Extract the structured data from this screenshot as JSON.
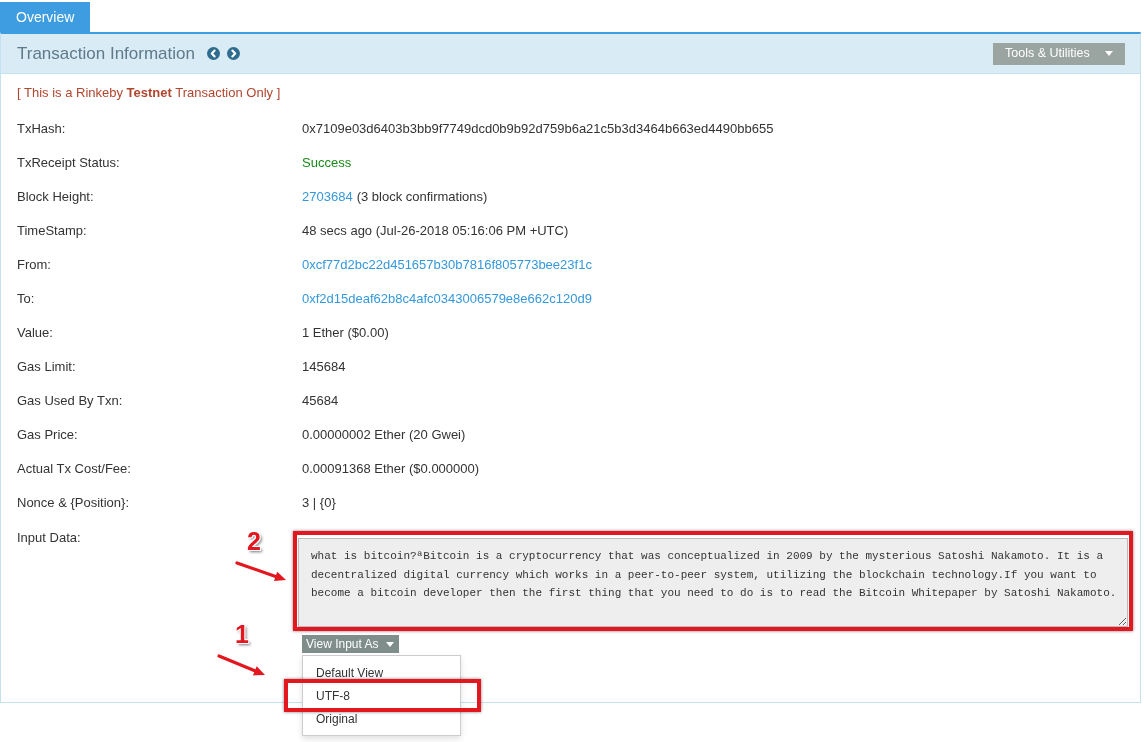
{
  "tabs": [
    {
      "label": "Overview",
      "selected": true
    }
  ],
  "panel": {
    "title": "Transaction Information",
    "tools_button": "Tools & Utilities"
  },
  "notice": "[ This is a Rinkeby **Testnet** Transaction Only ]",
  "fields": [
    {
      "label": "TxHash:",
      "kind": "text",
      "value": "0x7109e03d6403b3bb9f7749dcd0b9b92d759b6a21c5b3d3464b663ed4490bb655"
    },
    {
      "label": "TxReceipt Status:",
      "kind": "status",
      "value": "Success"
    },
    {
      "label": "Block Height:",
      "kind": "link",
      "value": "2703684",
      "note": "(3 block confirmations)"
    },
    {
      "label": "TimeStamp:",
      "kind": "text",
      "value": "48 secs ago (Jul-26-2018 05:16:06 PM +UTC)"
    },
    {
      "label": "From:",
      "kind": "link",
      "value": "0xcf77d2bc22d451657b30b7816f805773bee23f1c"
    },
    {
      "label": "To:",
      "kind": "link",
      "value": "0xf2d15deaf62b8c4afc0343006579e8e662c120d9"
    },
    {
      "label": "Value:",
      "kind": "text",
      "value": "1 Ether ($0.00)"
    },
    {
      "label": "Gas Limit:",
      "kind": "text",
      "value": "145684"
    },
    {
      "label": "Gas Used By Txn:",
      "kind": "text",
      "value": "45684"
    },
    {
      "label": "Gas Price:",
      "kind": "text",
      "value": "0.00000002 Ether (20 Gwei)"
    },
    {
      "label": "Actual Tx Cost/Fee:",
      "kind": "text",
      "value": "0.00091368 Ether ($0.000000)"
    },
    {
      "label": "Nonce & {Position}:",
      "kind": "text",
      "value": "3 | {0}"
    }
  ],
  "input_data": {
    "label": "Input Data:",
    "value": "what is bitcoin?ªBitcoin is a cryptocurrency that was conceptualized in 2009 by the mysterious Satoshi Nakamoto. It is a decentralized digital currency which works in a peer-to-peer system, utilizing the blockchain technology.If you want to become a bitcoin developer then the first thing that you need to do is to read the Bitcoin Whitepaper by Satoshi Nakamoto.",
    "annotation": "2",
    "view_button": "View Input As",
    "menu": [
      {
        "label": "Default View",
        "selected": false
      },
      {
        "label": "UTF-8",
        "selected": false,
        "annotation": "1"
      },
      {
        "label": "Original",
        "selected": false
      }
    ]
  }
}
